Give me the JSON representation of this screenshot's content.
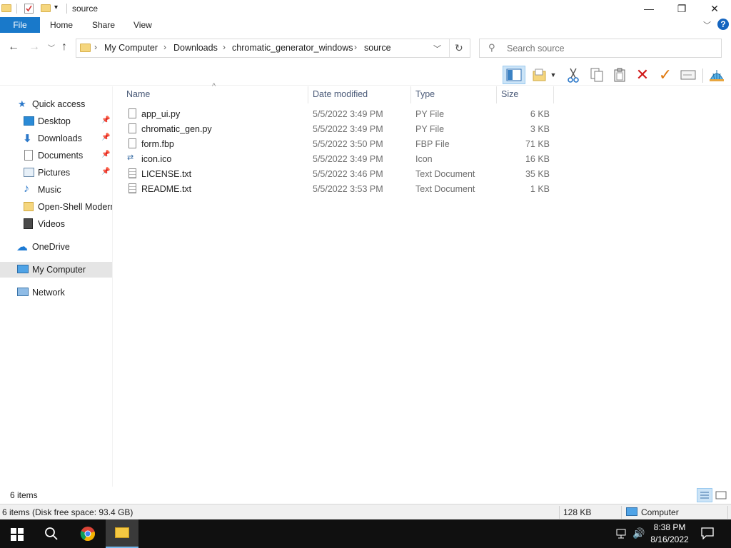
{
  "window": {
    "title": "source",
    "controls": {
      "minimize": "—",
      "maximize": "❐",
      "close": "✕"
    }
  },
  "ribbon": {
    "tabs": [
      "File",
      "Home",
      "Share",
      "View"
    ],
    "help": "?"
  },
  "address": {
    "crumbs": [
      "My Computer",
      "Downloads",
      "chromatic_generator_windows",
      "source"
    ],
    "search_placeholder": "Search source"
  },
  "nav_pane": {
    "quick_access": "Quick access",
    "items": [
      {
        "label": "Desktop",
        "pinned": true
      },
      {
        "label": "Downloads",
        "pinned": true
      },
      {
        "label": "Documents",
        "pinned": true
      },
      {
        "label": "Pictures",
        "pinned": true
      },
      {
        "label": "Music",
        "pinned": false
      },
      {
        "label": "Open-Shell Modern",
        "pinned": false
      },
      {
        "label": "Videos",
        "pinned": false
      }
    ],
    "onedrive": "OneDrive",
    "my_computer": "My Computer",
    "network": "Network"
  },
  "columns": {
    "name": "Name",
    "date": "Date modified",
    "type": "Type",
    "size": "Size"
  },
  "files": [
    {
      "name": "app_ui.py",
      "date": "5/5/2022 3:49 PM",
      "type": "PY File",
      "size": "6 KB"
    },
    {
      "name": "chromatic_gen.py",
      "date": "5/5/2022 3:49 PM",
      "type": "PY File",
      "size": "3 KB"
    },
    {
      "name": "form.fbp",
      "date": "5/5/2022 3:50 PM",
      "type": "FBP File",
      "size": "71 KB"
    },
    {
      "name": "icon.ico",
      "date": "5/5/2022 3:49 PM",
      "type": "Icon",
      "size": "16 KB"
    },
    {
      "name": "LICENSE.txt",
      "date": "5/5/2022 3:46 PM",
      "type": "Text Document",
      "size": "35 KB"
    },
    {
      "name": "README.txt",
      "date": "5/5/2022 3:53 PM",
      "type": "Text Document",
      "size": "1 KB"
    }
  ],
  "status": {
    "item_count": "6 items",
    "disk_info": "6 items (Disk free space: 93.4 GB)",
    "total_size": "128 KB",
    "location": "Computer"
  },
  "taskbar": {
    "time": "8:38 PM",
    "date": "8/16/2022"
  },
  "colors": {
    "accent": "#1979ca",
    "selected_nav": "#e5e5e5",
    "taskbar": "#101010"
  }
}
